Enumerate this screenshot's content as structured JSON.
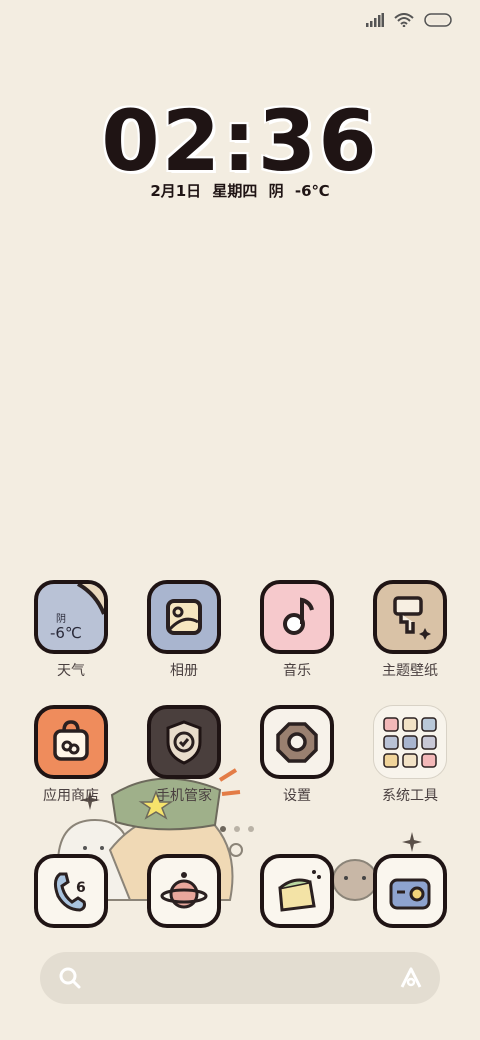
{
  "clock": {
    "time": "02:36",
    "date": "2月1日  星期四  阴  -6℃"
  },
  "weather_widget": {
    "condition": "阴",
    "temp": "-6℃"
  },
  "apps": [
    {
      "label": "天气",
      "icon": "weather-icon"
    },
    {
      "label": "相册",
      "icon": "gallery-icon"
    },
    {
      "label": "音乐",
      "icon": "music-icon"
    },
    {
      "label": "主题壁纸",
      "icon": "theme-brush-icon"
    },
    {
      "label": "应用商店",
      "icon": "app-store-bag-icon"
    },
    {
      "label": "手机管家",
      "icon": "security-shield-icon"
    },
    {
      "label": "设置",
      "icon": "settings-gear-icon"
    },
    {
      "label": "系统工具",
      "icon": "system-tools-folder-icon"
    }
  ],
  "dock": [
    {
      "icon": "phone-icon"
    },
    {
      "icon": "browser-planet-icon"
    },
    {
      "icon": "notes-icon"
    },
    {
      "icon": "camera-icon"
    }
  ],
  "colors": {
    "background": "#f3ede1",
    "weather": "#b9c2d6",
    "gallery": "#a9b5cf",
    "music": "#f6c9cc",
    "theme": "#d9c2a6",
    "store": "#ef8c5c",
    "security": "#4a3f3d",
    "settings": "#f7f2ea"
  }
}
